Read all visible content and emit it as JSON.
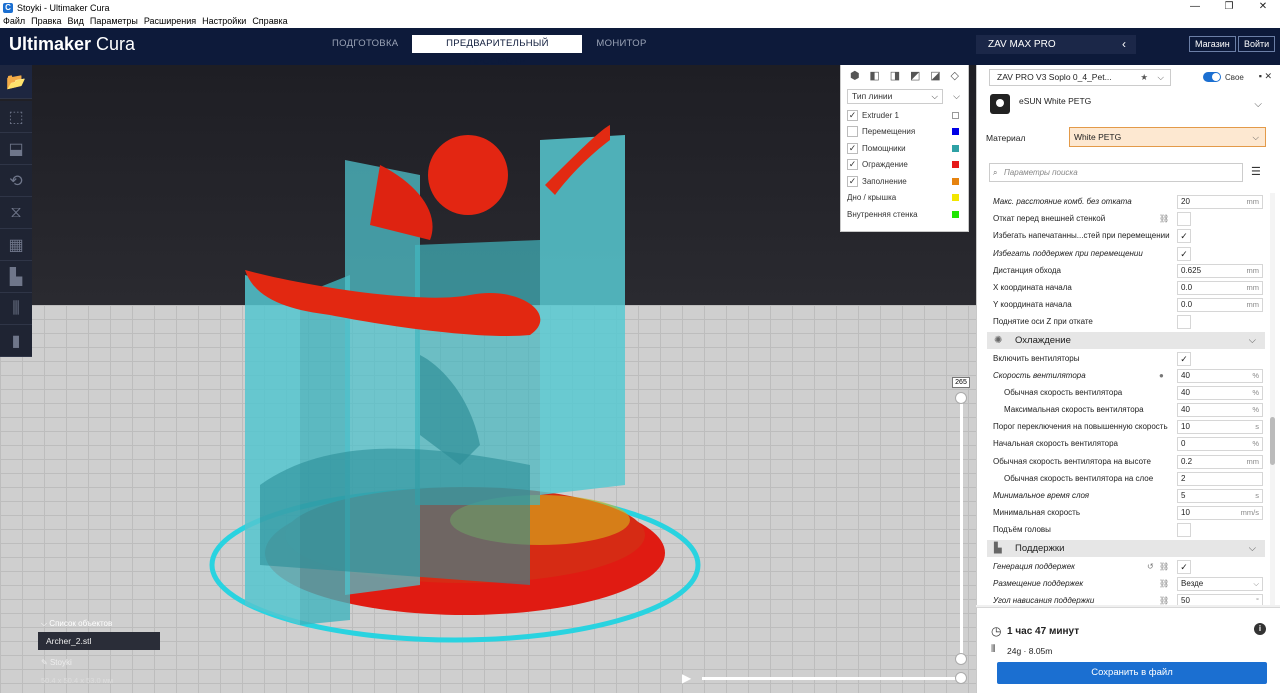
{
  "window": {
    "title": "Stoyki - Ultimaker Cura",
    "controls": [
      "—",
      "❐",
      "✕"
    ]
  },
  "menu": [
    "Файл",
    "Правка",
    "Вид",
    "Параметры",
    "Расширения",
    "Настройки",
    "Справка"
  ],
  "header": {
    "logo_bold": "Ultimaker",
    "logo_light": " Cura",
    "stages": [
      "ПОДГОТОВКА",
      "ПРЕДВАРИТЕЛЬНЫЙ ПРОСМОТР",
      "МОНИТОР"
    ],
    "printer": "ZAV MAX PRO",
    "marketplace": "Магазин",
    "signin": "Войти"
  },
  "legend": {
    "line_type": "Тип линии",
    "items": [
      {
        "label": "Extruder 1",
        "checked": true,
        "color": "#ffffff"
      },
      {
        "label": "Перемещения",
        "checked": false,
        "color": "#0000e6"
      },
      {
        "label": "Помощники",
        "checked": true,
        "color": "#2ea1a5"
      },
      {
        "label": "Ограждение",
        "checked": true,
        "color": "#e61919"
      },
      {
        "label": "Заполнение",
        "checked": true,
        "color": "#e6830f"
      },
      {
        "label": "Дно / крышка",
        "checked": null,
        "color": "#f2e600"
      },
      {
        "label": "Внутренняя стенка",
        "checked": null,
        "color": "#1ee600"
      }
    ]
  },
  "layer": {
    "current": "265"
  },
  "objects": {
    "title": "Список объектов",
    "file": "Archer_2.stl",
    "name": "Stoyki",
    "dims": "50.4 x 50.4 x 53.0 мм"
  },
  "panel": {
    "profile": "ZAV PRO V3 Soplo 0_4_Pet...",
    "custom": "Свое",
    "material_brand": "eSUN White PETG",
    "material_label": "Материал",
    "material_value": "White PETG",
    "search_placeholder": "Параметры поиска"
  },
  "settings": [
    {
      "type": "field",
      "label": "Макс. расстояние комб. без отката",
      "value": "20",
      "unit": "mm",
      "italic": true
    },
    {
      "type": "check",
      "label": "Откат перед внешней стенкой",
      "value": "",
      "link": true
    },
    {
      "type": "check",
      "label": "Избегать напечатанны...стей при перемещении",
      "value": "✓"
    },
    {
      "type": "check",
      "label": "Избегать поддержек при перемещении",
      "value": "✓",
      "italic": true
    },
    {
      "type": "field",
      "label": "Дистанция обхода",
      "value": "0.625",
      "unit": "mm"
    },
    {
      "type": "field",
      "label": "X координата начала",
      "value": "0.0",
      "unit": "mm"
    },
    {
      "type": "field",
      "label": "Y координата начала",
      "value": "0.0",
      "unit": "mm"
    },
    {
      "type": "check",
      "label": "Поднятие оси Z при откате",
      "value": ""
    },
    {
      "type": "section",
      "label": "Охлаждение",
      "icon": "✺"
    },
    {
      "type": "check",
      "label": "Включить вентиляторы",
      "value": "✓"
    },
    {
      "type": "field",
      "label": "Скорость вентилятора",
      "value": "40",
      "unit": "%",
      "italic": true,
      "info": true
    },
    {
      "type": "field",
      "label": "Обычная скорость вентилятора",
      "value": "40",
      "unit": "%",
      "indent": true
    },
    {
      "type": "field",
      "label": "Максимальная скорость вентилятора",
      "value": "40",
      "unit": "%",
      "indent": true
    },
    {
      "type": "field",
      "label": "Порог переключения на повышенную скорость",
      "value": "10",
      "unit": "s"
    },
    {
      "type": "field",
      "label": "Начальная скорость вентилятора",
      "value": "0",
      "unit": "%"
    },
    {
      "type": "field",
      "label": "Обычная скорость вентилятора на высоте",
      "value": "0.2",
      "unit": "mm"
    },
    {
      "type": "field",
      "label": "Обычная скорость вентилятора на слое",
      "value": "2",
      "unit": "",
      "indent": true
    },
    {
      "type": "field",
      "label": "Минимальное время слоя",
      "value": "5",
      "unit": "s",
      "italic": true
    },
    {
      "type": "field",
      "label": "Минимальная скорость",
      "value": "10",
      "unit": "mm/s"
    },
    {
      "type": "check",
      "label": "Подъём головы",
      "value": ""
    },
    {
      "type": "section",
      "label": "Поддержки",
      "icon": "▙"
    },
    {
      "type": "check",
      "label": "Генерация поддержек",
      "value": "✓",
      "italic": true,
      "link": true,
      "reset": true
    },
    {
      "type": "field",
      "label": "Размещение поддержек",
      "value": "Везде",
      "unit": "⌵",
      "italic": true,
      "link": true
    },
    {
      "type": "field",
      "label": "Угол нависания поддержки",
      "value": "50",
      "unit": "°",
      "italic": true,
      "link": true
    }
  ],
  "print": {
    "time": "1 час 47 минут",
    "usage": "24g · 8.05m",
    "save": "Сохранить в файл"
  }
}
